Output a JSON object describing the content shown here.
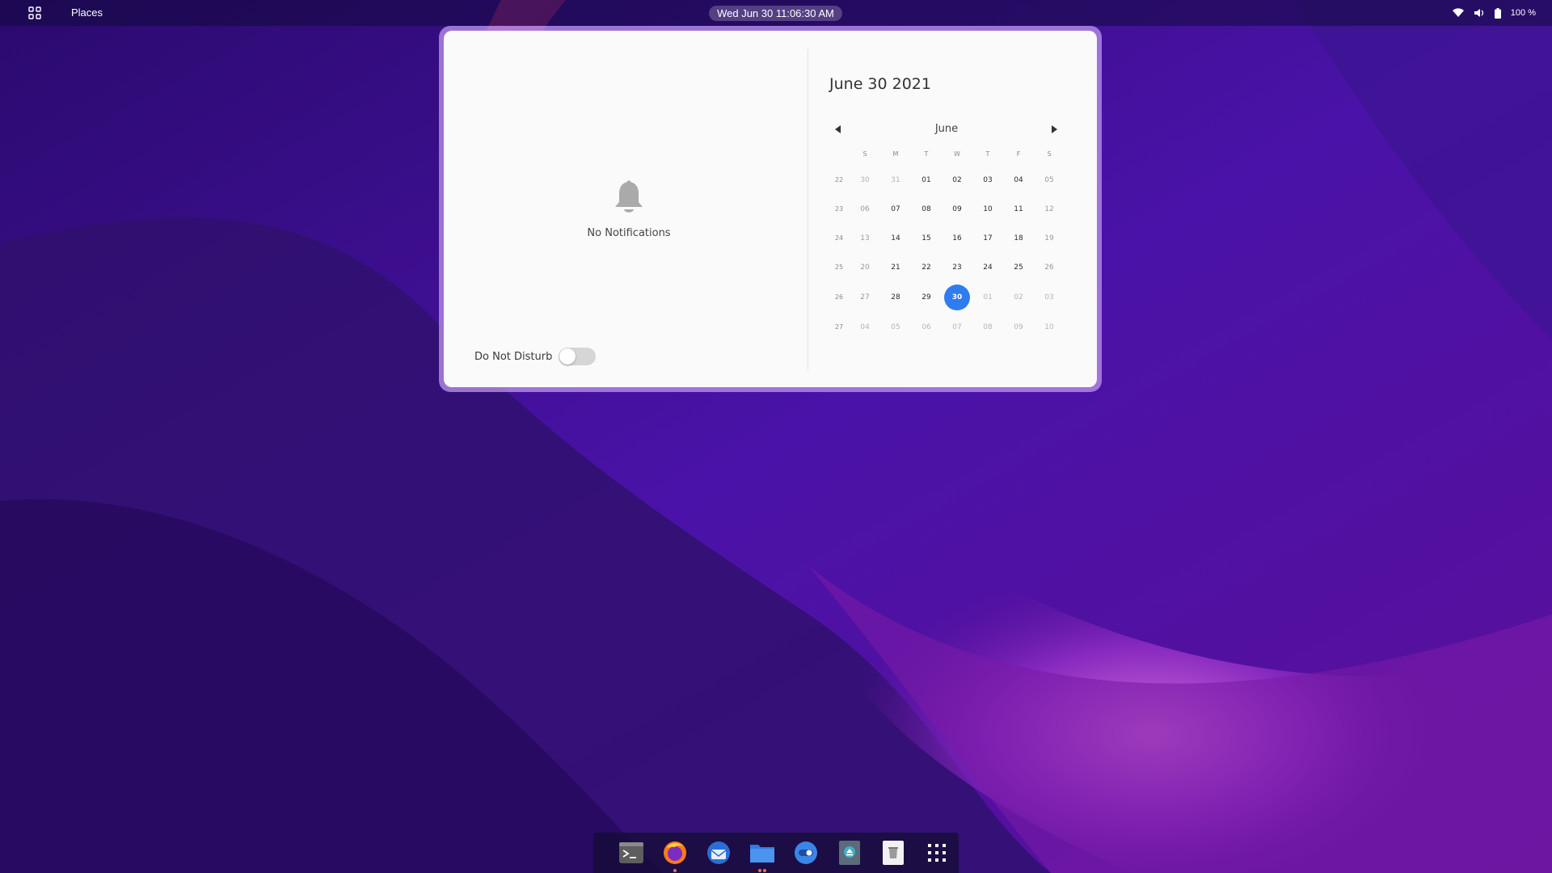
{
  "topbar": {
    "activities_icon": "grid-icon",
    "places_label": "Places",
    "clock": "Wed Jun 30  11:06:30 AM",
    "tray_icons": [
      "wifi-icon",
      "volume-icon",
      "battery-icon"
    ],
    "battery_text": "100 %"
  },
  "notifications": {
    "bell_icon": "bell-icon",
    "empty_text": "No Notifications",
    "dnd_label": "Do Not Disturb",
    "dnd_enabled": false
  },
  "calendar": {
    "date_header": "June 30 2021",
    "month_label": "June",
    "prev_icon": "chevron-left-icon",
    "next_icon": "chevron-right-icon",
    "weekday_headers": [
      "S",
      "M",
      "T",
      "W",
      "T",
      "F",
      "S"
    ],
    "week_numbers": [
      "22",
      "23",
      "24",
      "25",
      "26",
      "27"
    ],
    "weeks": [
      [
        "30",
        "31",
        "01",
        "02",
        "03",
        "04",
        "05"
      ],
      [
        "06",
        "07",
        "08",
        "09",
        "10",
        "11",
        "12"
      ],
      [
        "13",
        "14",
        "15",
        "16",
        "17",
        "18",
        "19"
      ],
      [
        "20",
        "21",
        "22",
        "23",
        "24",
        "25",
        "26"
      ],
      [
        "27",
        "28",
        "29",
        "30",
        "01",
        "02",
        "03"
      ],
      [
        "04",
        "05",
        "06",
        "07",
        "08",
        "09",
        "10"
      ]
    ],
    "today": "30",
    "accent_color": "#2f7cf0"
  },
  "dock": {
    "items": [
      {
        "name": "terminal",
        "icon": "terminal-icon",
        "running": false
      },
      {
        "name": "firefox",
        "icon": "firefox-icon",
        "running": true
      },
      {
        "name": "thunderbird",
        "icon": "thunderbird-icon",
        "running": false
      },
      {
        "name": "files",
        "icon": "folder-icon",
        "running": true
      },
      {
        "name": "toggle-app",
        "icon": "toggle-app-icon",
        "running": false
      },
      {
        "name": "installer",
        "icon": "installer-icon",
        "running": false
      },
      {
        "name": "trash",
        "icon": "trash-icon",
        "running": false
      },
      {
        "name": "show-apps",
        "icon": "app-grid-icon",
        "running": false
      }
    ],
    "running_dot_color": "#ff6a3d"
  }
}
